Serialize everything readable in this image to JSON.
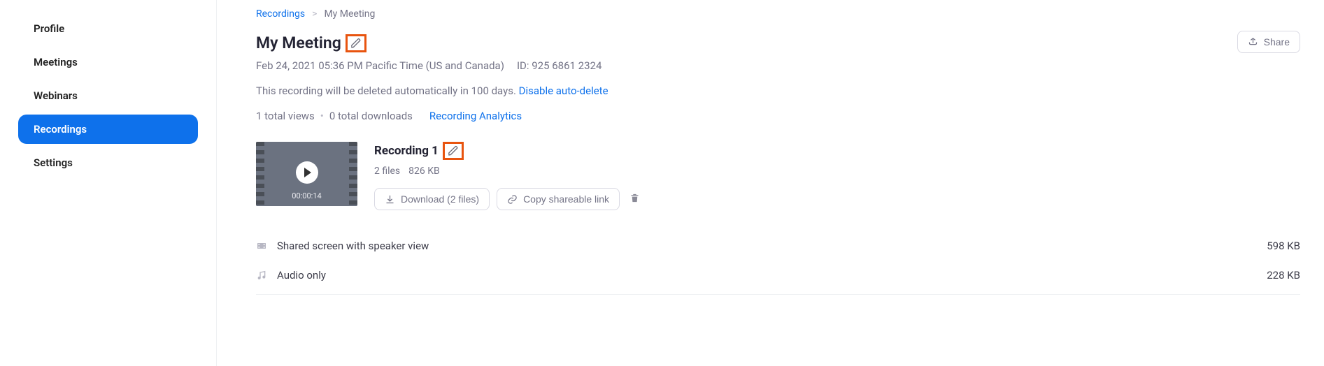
{
  "sidebar": {
    "items": [
      {
        "label": "Profile"
      },
      {
        "label": "Meetings"
      },
      {
        "label": "Webinars"
      },
      {
        "label": "Recordings"
      },
      {
        "label": "Settings"
      }
    ]
  },
  "breadcrumb": {
    "root": "Recordings",
    "sep": ">",
    "current": "My Meeting"
  },
  "page": {
    "title": "My Meeting",
    "datetime": "Feb 24, 2021 05:36 PM Pacific Time (US and Canada)",
    "meeting_id": "ID: 925 6861 2324",
    "auto_delete_msg": "This recording will be deleted automatically in 100 days.",
    "disable_link": "Disable auto-delete",
    "total_views": "1 total views",
    "total_downloads": "0 total downloads",
    "analytics_link": "Recording Analytics"
  },
  "share_button": "Share",
  "recording": {
    "title": "Recording 1",
    "duration": "00:00:14",
    "files_label": "2 files",
    "size": "826 KB",
    "download_label": "Download (2 files)",
    "copy_label": "Copy shareable link"
  },
  "files": [
    {
      "name": "Shared screen with speaker view",
      "size": "598 KB",
      "type": "video"
    },
    {
      "name": "Audio only",
      "size": "228 KB",
      "type": "audio"
    }
  ]
}
